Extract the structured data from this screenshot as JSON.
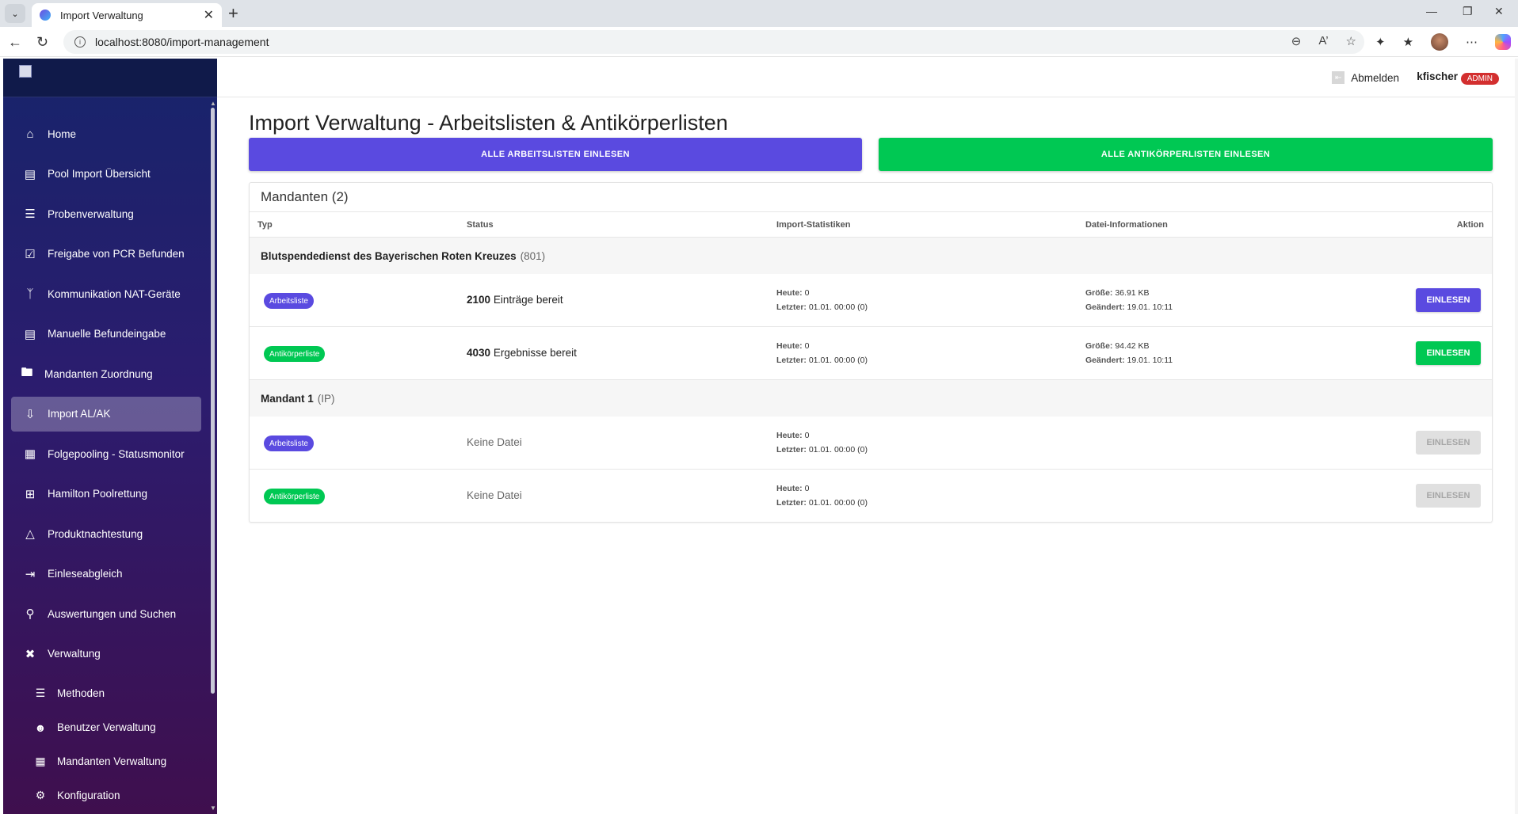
{
  "browser": {
    "tab_title": "Import Verwaltung",
    "url": "localhost:8080/import-management"
  },
  "sidebar": {
    "items": [
      {
        "label": "Home",
        "icon": "home-icon"
      },
      {
        "label": "Pool Import Übersicht",
        "icon": "list-doc-icon"
      },
      {
        "label": "Probenverwaltung",
        "icon": "menu-lines-icon"
      },
      {
        "label": "Freigabe von PCR Befunden",
        "icon": "clipboard-check-icon"
      },
      {
        "label": "Kommunikation NAT-Geräte",
        "icon": "network-icon"
      },
      {
        "label": "Manuelle Befundeingabe",
        "icon": "document-icon"
      },
      {
        "label": "Mandanten Zuordnung",
        "icon": "folder-icon"
      },
      {
        "label": "Import AL/AK",
        "icon": "file-import-icon"
      },
      {
        "label": "Folgepooling - Statusmonitor",
        "icon": "dashboard-icon"
      },
      {
        "label": "Hamilton Poolrettung",
        "icon": "plus-box-icon"
      },
      {
        "label": "Produktnachtestung",
        "icon": "flask-icon"
      },
      {
        "label": "Einleseabgleich",
        "icon": "arrow-compare-icon"
      },
      {
        "label": "Auswertungen und Suchen",
        "icon": "search-icon"
      },
      {
        "label": "Verwaltung",
        "icon": "tools-icon"
      }
    ],
    "sub_items": [
      {
        "label": "Methoden",
        "icon": "list-icon"
      },
      {
        "label": "Benutzer Verwaltung",
        "icon": "users-icon"
      },
      {
        "label": "Mandanten Verwaltung",
        "icon": "building-icon"
      },
      {
        "label": "Konfiguration",
        "icon": "gear-icon"
      }
    ]
  },
  "header": {
    "logout_label": "Abmelden",
    "username": "kfischer",
    "role_badge": "ADMIN"
  },
  "main": {
    "title": "Import Verwaltung - Arbeitslisten & Antikörperlisten",
    "btn_all_arbeitslisten": "ALLE ARBEITSLISTEN EINLESEN",
    "btn_all_antikoerperlisten": "ALLE ANTIKÖRPERLISTEN EINLESEN",
    "card_title": "Mandanten (2)",
    "columns": {
      "typ": "Typ",
      "status": "Status",
      "stats": "Import-Statistiken",
      "file": "Datei-Informationen",
      "action": "Aktion"
    },
    "groups": [
      {
        "name": "Blutspendedienst des Bayerischen Roten Kreuzes",
        "code": "(801)",
        "rows": [
          {
            "type": "Arbeitsliste",
            "count": "2100",
            "status": "Einträge bereit",
            "heute_label": "Heute:",
            "heute": "0",
            "letzter_label": "Letzter:",
            "letzter": "01.01. 00:00 (0)",
            "size_label": "Größe:",
            "size": "36.91 KB",
            "changed_label": "Geändert:",
            "changed": "19.01. 10:11",
            "action": "EINLESEN"
          },
          {
            "type": "Antikörperliste",
            "count": "4030",
            "status": "Ergebnisse bereit",
            "heute_label": "Heute:",
            "heute": "0",
            "letzter_label": "Letzter:",
            "letzter": "01.01. 00:00 (0)",
            "size_label": "Größe:",
            "size": "94.42 KB",
            "changed_label": "Geändert:",
            "changed": "19.01. 10:11",
            "action": "EINLESEN"
          }
        ]
      },
      {
        "name": "Mandant 1",
        "code": "(IP)",
        "rows": [
          {
            "type": "Arbeitsliste",
            "status": "Keine Datei",
            "heute_label": "Heute:",
            "heute": "0",
            "letzter_label": "Letzter:",
            "letzter": "01.01. 00:00 (0)",
            "action": "EINLESEN"
          },
          {
            "type": "Antikörperliste",
            "status": "Keine Datei",
            "heute_label": "Heute:",
            "heute": "0",
            "letzter_label": "Letzter:",
            "letzter": "01.01. 00:00 (0)",
            "action": "EINLESEN"
          }
        ]
      }
    ]
  },
  "colors": {
    "purple": "#5a4ae0",
    "green": "#00c853",
    "admin_red": "#d32f2f"
  }
}
